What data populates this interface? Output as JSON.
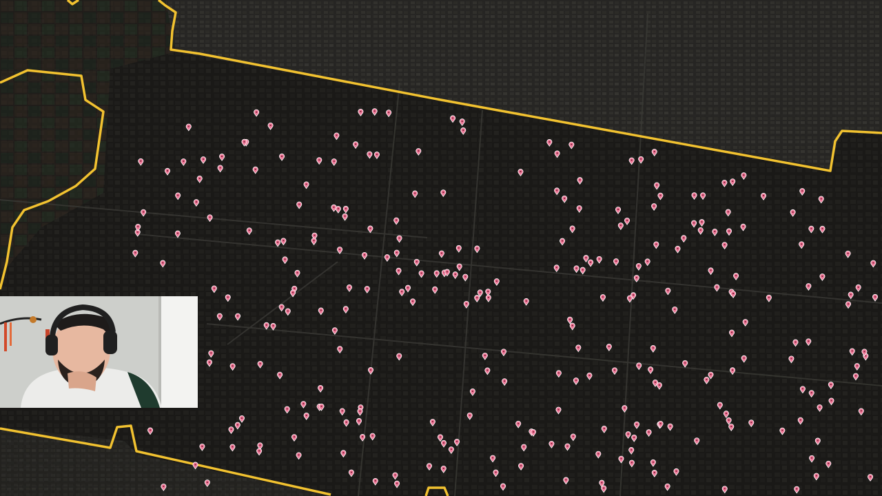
{
  "view": {
    "type": "satellite-map",
    "base_color": "#1d1c1a",
    "boundary_color": "#f2c230",
    "marker_color": "#f07a9a",
    "marker_count": 300
  },
  "overlay": {
    "webcam": {
      "description": "streamer-webcam"
    }
  }
}
